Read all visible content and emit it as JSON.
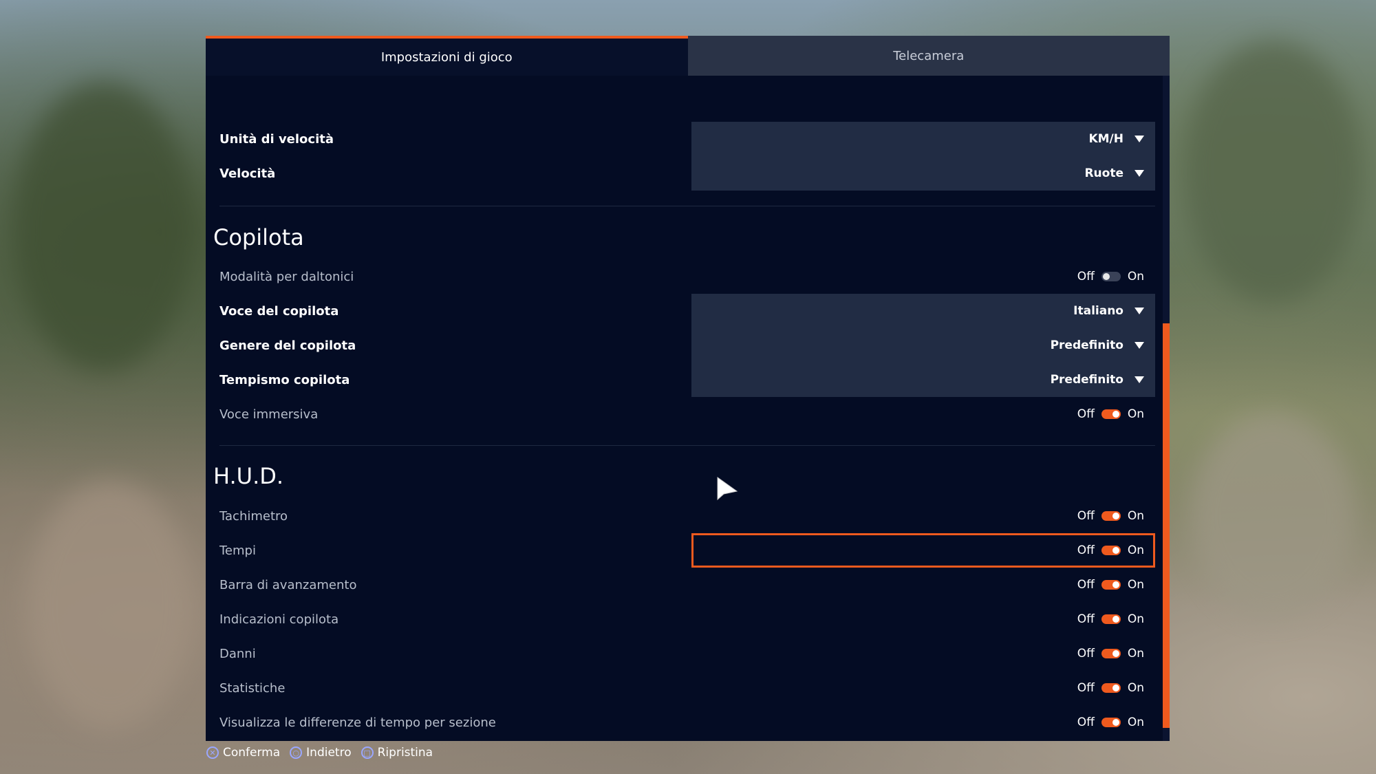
{
  "tabs": [
    {
      "label": "Impostazioni di gioco",
      "active": true
    },
    {
      "label": "Telecamera",
      "active": false
    }
  ],
  "speed": {
    "unit_label": "Unità di velocità",
    "unit_value": "KM/H",
    "speed_label": "Velocità",
    "speed_value": "Ruote"
  },
  "copilot": {
    "title": "Copilota",
    "colorblind_label": "Modalità per daltonici",
    "colorblind_on": false,
    "voice_label": "Voce del copilota",
    "voice_value": "Italiano",
    "gender_label": "Genere del copilota",
    "gender_value": "Predefinito",
    "timing_label": "Tempismo copilota",
    "timing_value": "Predefinito",
    "immersive_label": "Voce immersiva",
    "immersive_on": true
  },
  "hud": {
    "title": "H.U.D.",
    "items": [
      {
        "label": "Tachimetro",
        "on": true
      },
      {
        "label": "Tempi",
        "on": true,
        "selected": true
      },
      {
        "label": "Barra di avanzamento",
        "on": true
      },
      {
        "label": "Indicazioni copilota",
        "on": true
      },
      {
        "label": "Danni",
        "on": true
      },
      {
        "label": "Statistiche",
        "on": true
      },
      {
        "label": "Visualizza le differenze di tempo per sezione",
        "on": true
      }
    ]
  },
  "toggle": {
    "off": "Off",
    "on": "On"
  },
  "footer": {
    "confirm": "Conferma",
    "back": "Indietro",
    "reset": "Ripristina"
  },
  "colors": {
    "accent": "#ef5a1e",
    "panel": "#040c24",
    "dropdown_bg": "#212c44"
  },
  "icons": [
    "caret-down-icon",
    "cross-button-icon",
    "circle-button-icon",
    "square-button-icon",
    "mouse-pointer-icon"
  ]
}
